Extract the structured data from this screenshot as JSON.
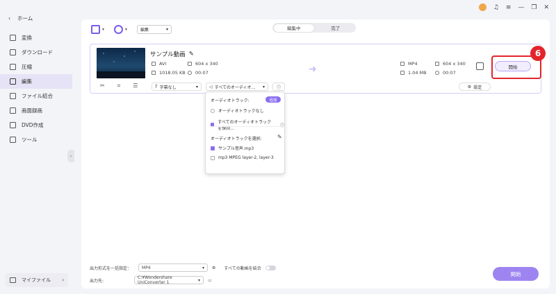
{
  "sidebar": {
    "home_label": "ホーム",
    "items": [
      {
        "label": "変換",
        "icon": "convert-icon"
      },
      {
        "label": "ダウンロード",
        "icon": "download-icon"
      },
      {
        "label": "圧縮",
        "icon": "compress-icon"
      },
      {
        "label": "編集",
        "icon": "edit-icon",
        "active": true
      },
      {
        "label": "ファイル結合",
        "icon": "merge-icon"
      },
      {
        "label": "画面録画",
        "icon": "screen-record-icon"
      },
      {
        "label": "DVD作成",
        "icon": "dvd-icon"
      },
      {
        "label": "ツール",
        "icon": "tools-icon"
      }
    ],
    "myfile_label": "マイファイル"
  },
  "toolbar": {
    "select_value": "編集",
    "tabs": [
      {
        "label": "編集中",
        "active": true
      },
      {
        "label": "完了",
        "active": false
      }
    ]
  },
  "file": {
    "name": "サンプル動画",
    "source": {
      "format": "AVI",
      "resolution": "604 x 340",
      "size": "1018.05 KB",
      "duration": "00:07"
    },
    "target": {
      "format": "MP4",
      "resolution": "604 x 340",
      "size": "1.04 MB",
      "duration": "00:07"
    },
    "start_label": "開始",
    "subtitle_select": "字幕なし",
    "audio_select": "すべてのオーディオ...",
    "settings_label": "設定"
  },
  "annotation": {
    "step_number": "6",
    "color": "#e3242b"
  },
  "audio_popup": {
    "header": "オーディオトラック:",
    "add_label": "追加",
    "options": [
      {
        "label": "オーディオトラックなし",
        "selected": false
      },
      {
        "label": "すべてのオーディオトラックを保持...",
        "selected": true
      }
    ],
    "select_header": "オーディオトラックを選択:",
    "tracks": [
      {
        "label": "サンプル音声.mp3",
        "checked": true
      },
      {
        "label": "mp3 MPEG layer-2, layer-3",
        "checked": false
      }
    ]
  },
  "footer": {
    "format_label": "出力形式を一括指定：",
    "format_value": "MP4",
    "merge_label": "すべての動画を結合",
    "output_label": "出力先:",
    "output_value": "C:¥Wondershare UniConverter 1",
    "start_all_label": "開始"
  },
  "colors": {
    "accent": "#8b6ef0",
    "annotation_red": "#e3242b"
  }
}
